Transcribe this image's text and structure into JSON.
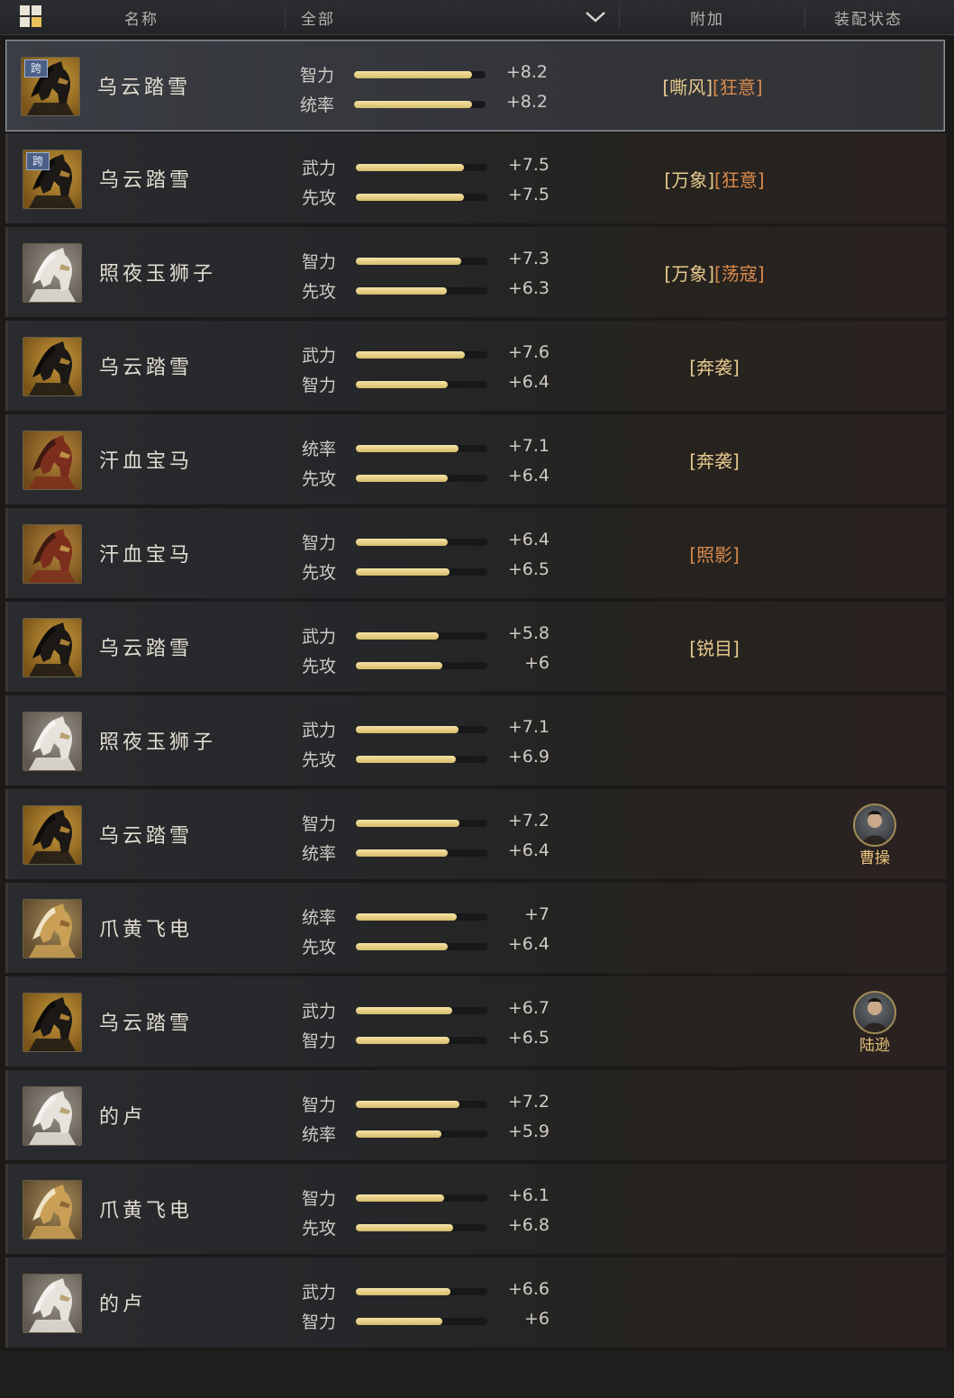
{
  "header": {
    "col_name": "名称",
    "filter_value": "全部",
    "col_extra": "附加",
    "col_status": "装配状态"
  },
  "rows": [
    {
      "name": "乌云踏雪",
      "horse": "black",
      "cross": "跨",
      "selected": true,
      "stats": [
        {
          "label": "智力",
          "value": "+8.2",
          "fill": 0.9
        },
        {
          "label": "统率",
          "value": "+8.2",
          "fill": 0.9
        }
      ],
      "traits": [
        {
          "text": "[嘶风]",
          "style": "a"
        },
        {
          "text": "[狂意]",
          "style": "b"
        }
      ],
      "general": ""
    },
    {
      "name": "乌云踏雪",
      "horse": "black",
      "cross": "跨",
      "selected": false,
      "stats": [
        {
          "label": "武力",
          "value": "+7.5",
          "fill": 0.82
        },
        {
          "label": "先攻",
          "value": "+7.5",
          "fill": 0.82
        }
      ],
      "traits": [
        {
          "text": "[万象]",
          "style": "a"
        },
        {
          "text": "[狂意]",
          "style": "b"
        }
      ],
      "general": ""
    },
    {
      "name": "照夜玉狮子",
      "horse": "white",
      "cross": "",
      "selected": false,
      "stats": [
        {
          "label": "智力",
          "value": "+7.3",
          "fill": 0.8
        },
        {
          "label": "先攻",
          "value": "+6.3",
          "fill": 0.69
        }
      ],
      "traits": [
        {
          "text": "[万象]",
          "style": "a"
        },
        {
          "text": "[荡寇]",
          "style": "b"
        }
      ],
      "general": ""
    },
    {
      "name": "乌云踏雪",
      "horse": "black",
      "cross": "",
      "selected": false,
      "stats": [
        {
          "label": "武力",
          "value": "+7.6",
          "fill": 0.83
        },
        {
          "label": "智力",
          "value": "+6.4",
          "fill": 0.7
        }
      ],
      "traits": [
        {
          "text": "[奔袭]",
          "style": "a"
        }
      ],
      "general": ""
    },
    {
      "name": "汗血宝马",
      "horse": "red",
      "cross": "",
      "selected": false,
      "stats": [
        {
          "label": "统率",
          "value": "+7.1",
          "fill": 0.78
        },
        {
          "label": "先攻",
          "value": "+6.4",
          "fill": 0.7
        }
      ],
      "traits": [
        {
          "text": "[奔袭]",
          "style": "a"
        }
      ],
      "general": ""
    },
    {
      "name": "汗血宝马",
      "horse": "red",
      "cross": "",
      "selected": false,
      "stats": [
        {
          "label": "智力",
          "value": "+6.4",
          "fill": 0.7
        },
        {
          "label": "先攻",
          "value": "+6.5",
          "fill": 0.71
        }
      ],
      "traits": [
        {
          "text": "[照影]",
          "style": "b"
        }
      ],
      "general": ""
    },
    {
      "name": "乌云踏雪",
      "horse": "black",
      "cross": "",
      "selected": false,
      "stats": [
        {
          "label": "武力",
          "value": "+5.8",
          "fill": 0.63
        },
        {
          "label": "先攻",
          "value": "+6",
          "fill": 0.66
        }
      ],
      "traits": [
        {
          "text": "[锐目]",
          "style": "a"
        }
      ],
      "general": ""
    },
    {
      "name": "照夜玉狮子",
      "horse": "white",
      "cross": "",
      "selected": false,
      "stats": [
        {
          "label": "武力",
          "value": "+7.1",
          "fill": 0.78
        },
        {
          "label": "先攻",
          "value": "+6.9",
          "fill": 0.76
        }
      ],
      "traits": [],
      "general": ""
    },
    {
      "name": "乌云踏雪",
      "horse": "black",
      "cross": "",
      "selected": false,
      "stats": [
        {
          "label": "智力",
          "value": "+7.2",
          "fill": 0.79
        },
        {
          "label": "统率",
          "value": "+6.4",
          "fill": 0.7
        }
      ],
      "traits": [],
      "general": "曹操"
    },
    {
      "name": "爪黄飞电",
      "horse": "gold",
      "cross": "",
      "selected": false,
      "stats": [
        {
          "label": "统率",
          "value": "+7",
          "fill": 0.77
        },
        {
          "label": "先攻",
          "value": "+6.4",
          "fill": 0.7
        }
      ],
      "traits": [],
      "general": ""
    },
    {
      "name": "乌云踏雪",
      "horse": "black",
      "cross": "",
      "selected": false,
      "stats": [
        {
          "label": "武力",
          "value": "+6.7",
          "fill": 0.73
        },
        {
          "label": "智力",
          "value": "+6.5",
          "fill": 0.71
        }
      ],
      "traits": [],
      "general": "陆逊"
    },
    {
      "name": "的卢",
      "horse": "white",
      "cross": "",
      "selected": false,
      "stats": [
        {
          "label": "智力",
          "value": "+7.2",
          "fill": 0.79
        },
        {
          "label": "统率",
          "value": "+5.9",
          "fill": 0.65
        }
      ],
      "traits": [],
      "general": ""
    },
    {
      "name": "爪黄飞电",
      "horse": "gold",
      "cross": "",
      "selected": false,
      "stats": [
        {
          "label": "智力",
          "value": "+6.1",
          "fill": 0.67
        },
        {
          "label": "先攻",
          "value": "+6.8",
          "fill": 0.74
        }
      ],
      "traits": [],
      "general": ""
    },
    {
      "name": "的卢",
      "horse": "white",
      "cross": "",
      "selected": false,
      "stats": [
        {
          "label": "武力",
          "value": "+6.6",
          "fill": 0.72
        },
        {
          "label": "智力",
          "value": "+6",
          "fill": 0.66
        }
      ],
      "traits": [],
      "general": ""
    }
  ]
}
